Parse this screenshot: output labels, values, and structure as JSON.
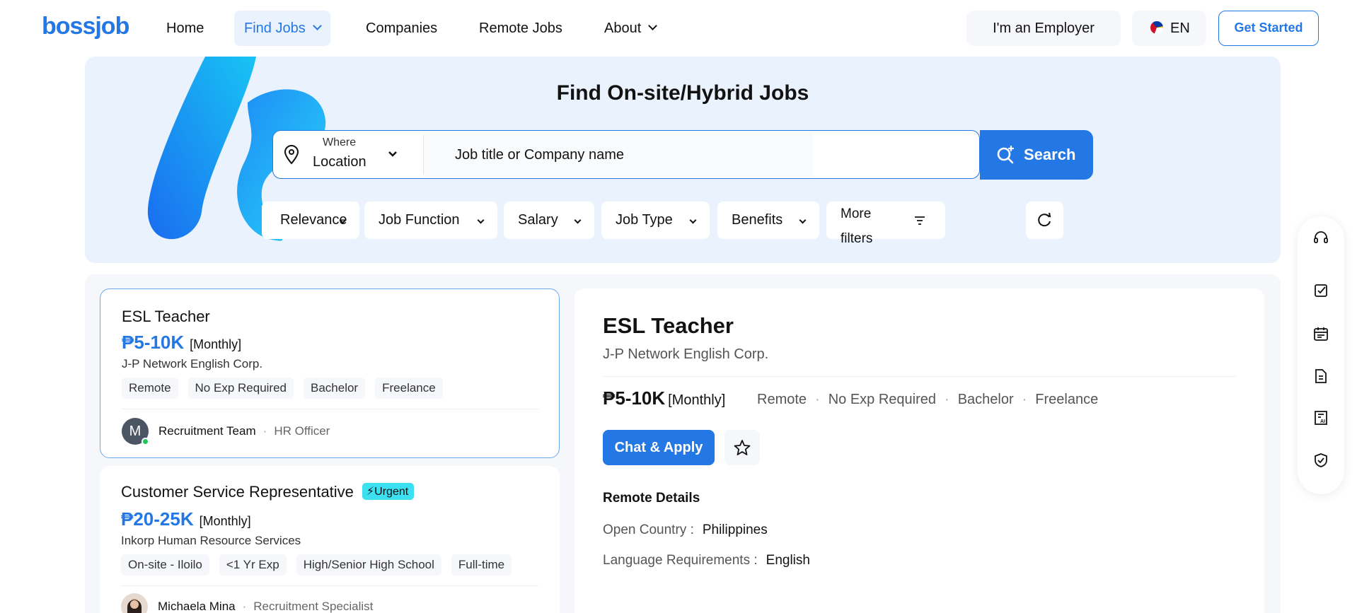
{
  "header": {
    "logo": "bossjob",
    "nav": [
      {
        "label": "Home"
      },
      {
        "label": "Find Jobs"
      },
      {
        "label": "Companies"
      },
      {
        "label": "Remote Jobs"
      },
      {
        "label": "About"
      }
    ],
    "employer_label": "I'm an Employer",
    "lang_label": "EN",
    "start_label": "Get Started"
  },
  "hero": {
    "title": "Find On-site/Hybrid Jobs",
    "where_label": "Where",
    "location_value": "Location",
    "search_placeholder": "Job title or Company name",
    "search_label": "Search",
    "filters": [
      "Relevance",
      "Job Function",
      "Salary",
      "Job Type",
      "Benefits"
    ],
    "more_filters": [
      "More",
      "filters"
    ]
  },
  "jobs": [
    {
      "title": "ESL Teacher",
      "badge": "",
      "salary": "₱5-10K",
      "period": "[Monthly]",
      "company": "J-P Network English Corp.",
      "tags": [
        "Remote",
        "No Exp Required",
        "Bachelor",
        "Freelance"
      ],
      "recruiter_initial": "M",
      "recruiter": "Recruitment Team",
      "role": "HR Officer"
    },
    {
      "title": "Customer Service Representative",
      "badge": "Urgent",
      "salary": "₱20-25K",
      "period": "[Monthly]",
      "company": "Inkorp Human Resource Services",
      "tags": [
        "On-site - Iloilo",
        "<1 Yr Exp",
        "High/Senior High School",
        "Full-time"
      ],
      "recruiter": "Michaela Mina",
      "role": "Recruitment Specialist"
    }
  ],
  "detail": {
    "title": "ESL Teacher",
    "company": "J-P Network English Corp.",
    "salary": "₱5-10K",
    "period": "[Monthly]",
    "tags": [
      "Remote",
      "No Exp Required",
      "Bachelor",
      "Freelance"
    ],
    "apply_label": "Chat & Apply",
    "remote_heading": "Remote Details",
    "open_country_label": "Open Country :",
    "open_country_value": "Philippines",
    "language_label": "Language Requirements :",
    "language_value": "English"
  },
  "sidebar_icons": [
    "headset-icon",
    "edit-note-icon",
    "calendar-icon",
    "document-icon",
    "ai-resume-icon",
    "shield-check-icon"
  ],
  "colors": {
    "brand": "#2378e5",
    "urgent": "#3ce0f0",
    "hero_bg": "#eaf2fd"
  }
}
